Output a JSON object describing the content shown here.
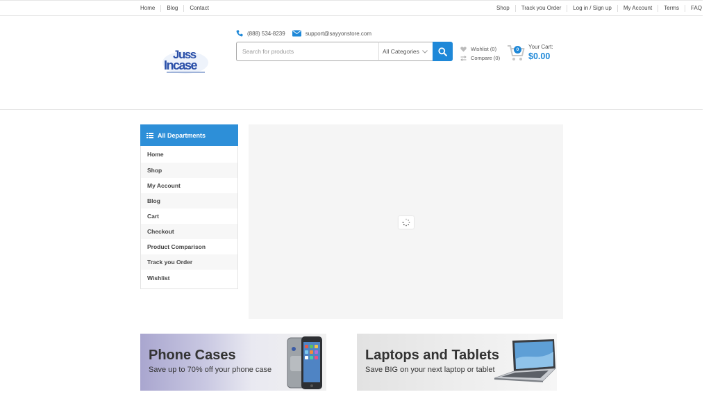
{
  "topbar": {
    "left": [
      "Home",
      "Blog",
      "Contact"
    ],
    "right": [
      "Shop",
      "Track you Order",
      "Log in / Sign up",
      "My Account",
      "Terms",
      "FAQ"
    ]
  },
  "header": {
    "phone": "(888) 534-8239",
    "email": "support@sayyonstore.com",
    "search_placeholder": "Search for products",
    "category": "All Categories",
    "wishlist": "Wishlist (0)",
    "compare": "Compare (0)",
    "cart_count": "0",
    "cart_label": "Your Cart:",
    "cart_total": "$0.00"
  },
  "departments": {
    "title": "All Departments",
    "items": [
      "Home",
      "Shop",
      "My Account",
      "Blog",
      "Cart",
      "Checkout",
      "Product Comparison",
      "Track you Order",
      "Wishlist"
    ]
  },
  "banners": [
    {
      "title": "Phone Cases",
      "subtitle": "Save up to 70% off your phone case"
    },
    {
      "title": "Laptops and Tablets",
      "subtitle": "Save BIG on your next laptop or tablet"
    }
  ],
  "colors": {
    "accent": "#1e88d8",
    "dept_header": "#2d8fd8"
  }
}
